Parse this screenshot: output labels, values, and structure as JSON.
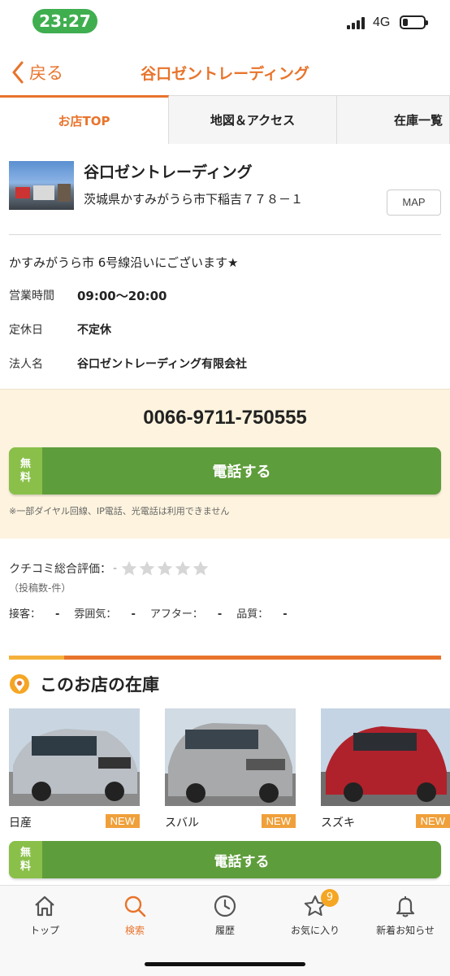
{
  "status_bar": {
    "time": "23:27",
    "network": "4G"
  },
  "header": {
    "back_label": "戻る",
    "title": "谷口ゼントレーディング"
  },
  "tabs": [
    {
      "label": "お店TOP",
      "active": true
    },
    {
      "label": "地図＆アクセス",
      "active": false
    },
    {
      "label": "在庫一覧",
      "active": false
    }
  ],
  "shop": {
    "name": "谷口ゼントレーディング",
    "address": "茨城県かすみがうら市下稲吉７７８－１",
    "map_button": "MAP",
    "catch_copy": "かすみがうら市 6号線沿いにございます★",
    "info": [
      {
        "key": "営業時間",
        "value": "09:00〜20:00"
      },
      {
        "key": "定休日",
        "value": "不定休"
      },
      {
        "key": "法人名",
        "value": "谷口ゼントレーディング有限会社"
      }
    ]
  },
  "phone": {
    "number": "0066-9711-750555",
    "free_line1": "無",
    "free_line2": "料",
    "call_label": "電話する",
    "note": "※一部ダイヤル回線、IP電話、光電話は利用できません"
  },
  "reviews": {
    "title": "クチコミ総合評価：",
    "score": "-",
    "stars_filled": 0,
    "stars_total": 5,
    "count": "（投稿数-件）",
    "items": [
      {
        "label": "接客：",
        "value": "-"
      },
      {
        "label": "雰囲気：",
        "value": "-"
      },
      {
        "label": "アフター：",
        "value": "-"
      },
      {
        "label": "品質：",
        "value": "-"
      }
    ]
  },
  "stock": {
    "title": "このお店の在庫",
    "new_label": "NEW",
    "cars": [
      {
        "maker": "日産",
        "color": "#b9bfc4"
      },
      {
        "maker": "スバル",
        "color": "#a7a9ab"
      },
      {
        "maker": "スズキ",
        "color": "#b0222b"
      }
    ]
  },
  "sticky_call": {
    "free_line1": "無",
    "free_line2": "料",
    "label": "電話する"
  },
  "bottom_nav": {
    "items": [
      {
        "label": "トップ",
        "icon": "home-icon"
      },
      {
        "label": "検索",
        "icon": "search-icon",
        "active": true
      },
      {
        "label": "履歴",
        "icon": "clock-icon"
      },
      {
        "label": "お気に入り",
        "icon": "star-icon",
        "badge": "9"
      },
      {
        "label": "新着お知らせ",
        "icon": "bell-icon"
      }
    ]
  },
  "colors": {
    "accent": "#e8742c",
    "call_green": "#5e9d3b",
    "free_green": "#8ac04a",
    "new_badge": "#f0a03a",
    "phone_bg": "#fdf3de"
  }
}
